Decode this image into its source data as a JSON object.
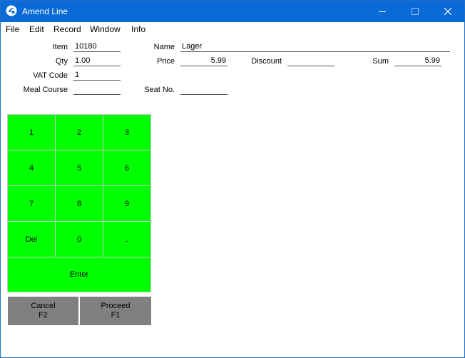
{
  "window": {
    "title": "Amend Line",
    "icon": "app-logo-icon",
    "controls": [
      "minimize-icon",
      "maximize-icon",
      "close-icon"
    ]
  },
  "menu": [
    "File",
    "Edit",
    "Record",
    "Window",
    "Info"
  ],
  "fields": {
    "item": {
      "label": "Item",
      "value": "10180"
    },
    "name": {
      "label": "Name",
      "value": "Lager"
    },
    "qty": {
      "label": "Qty",
      "value": "1.00"
    },
    "price": {
      "label": "Price",
      "value": "5.99"
    },
    "discount": {
      "label": "Discount",
      "value": ""
    },
    "sum": {
      "label": "Sum",
      "value": "5.99"
    },
    "vat_code": {
      "label": "VAT Code",
      "value": "1"
    },
    "meal_course": {
      "label": "Meal Course",
      "value": ""
    },
    "seat_no": {
      "label": "Seat No.",
      "value": ""
    }
  },
  "keypad": {
    "keys": [
      "1",
      "2",
      "3",
      "4",
      "5",
      "6",
      "7",
      "8",
      "9",
      "Del",
      "0",
      "."
    ],
    "enter": "Enter",
    "key_color": "#00ff00"
  },
  "actions": {
    "cancel": {
      "label": "Cancel",
      "shortcut": "F2"
    },
    "proceed": {
      "label": "Proceed",
      "shortcut": "F1"
    },
    "color": "#808080"
  },
  "colors": {
    "titlebar": "#0a6ad6"
  }
}
